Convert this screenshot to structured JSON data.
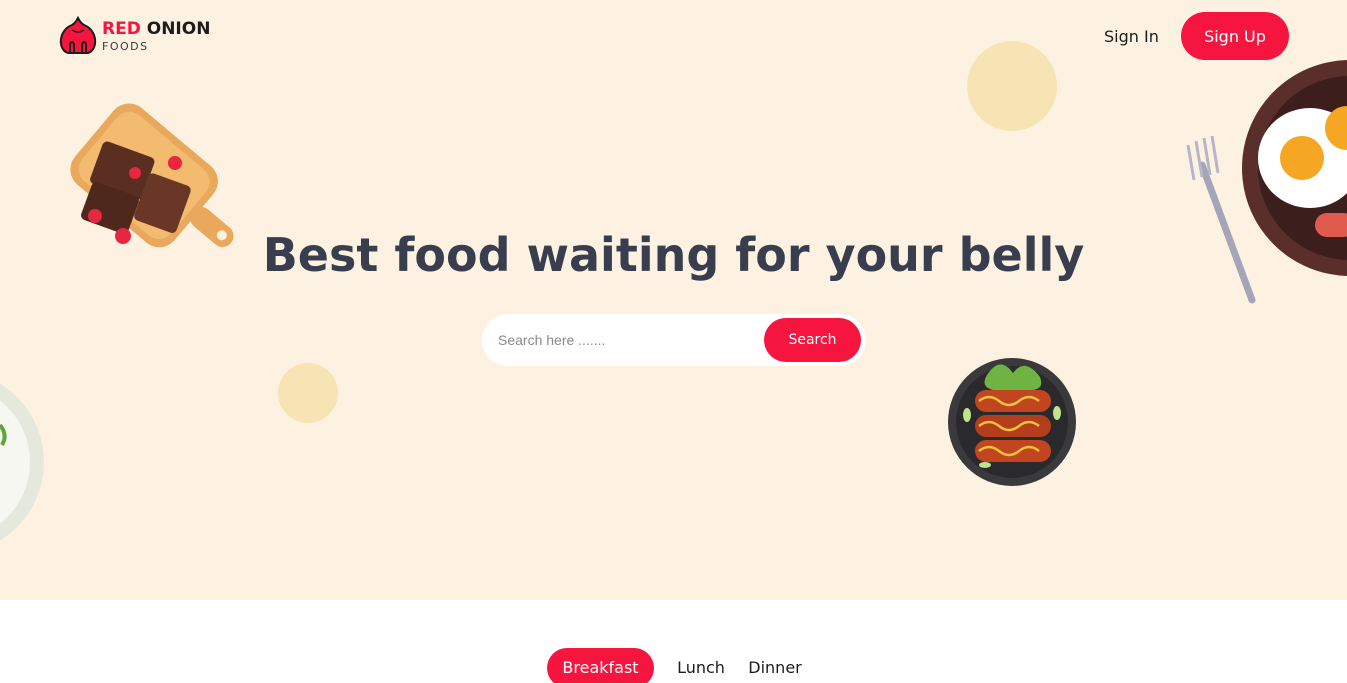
{
  "brand": {
    "name_part1": "RED",
    "name_part2": "ONION",
    "subtitle": "FOODS",
    "accent_color": "#f5153f"
  },
  "header": {
    "signin_label": "Sign In",
    "signup_label": "Sign Up"
  },
  "hero": {
    "headline": "Best food waiting for your belly",
    "background_color": "#fdf2e2",
    "search": {
      "placeholder": "Search here .......",
      "button_label": "Search"
    }
  },
  "tabs": {
    "items": [
      {
        "label": "Breakfast",
        "active": true
      },
      {
        "label": "Lunch",
        "active": false
      },
      {
        "label": "Dinner",
        "active": false
      }
    ]
  },
  "icons": {
    "logo": "onion-logo-icon"
  }
}
